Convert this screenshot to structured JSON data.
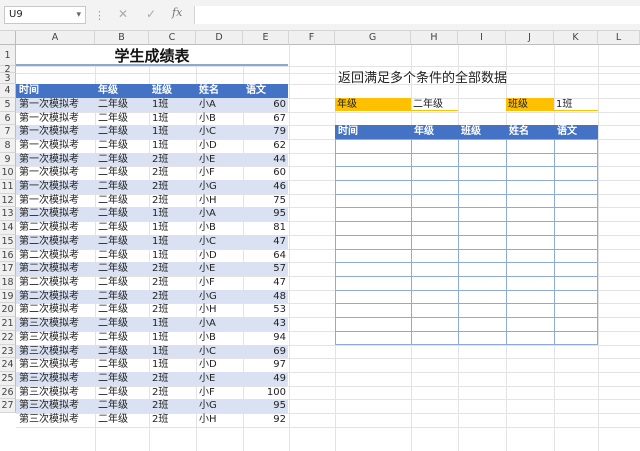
{
  "formula_bar": {
    "name_box": "U9",
    "fx_label": "fx",
    "formula": ""
  },
  "columns": [
    "A",
    "B",
    "C",
    "D",
    "E",
    "F",
    "G",
    "H",
    "I",
    "J",
    "K",
    "L"
  ],
  "rows": [
    "1",
    "2",
    "3",
    "4",
    "5",
    "6",
    "7",
    "8",
    "9",
    "10",
    "11",
    "12",
    "13",
    "14",
    "15",
    "16",
    "17",
    "18",
    "19",
    "20",
    "21",
    "22",
    "23",
    "24",
    "25",
    "26",
    "27"
  ],
  "table": {
    "title": "学生成绩表",
    "headers": [
      "时间",
      "年级",
      "班级",
      "姓名",
      "语文"
    ],
    "data": [
      [
        "第一次模拟考",
        "二年级",
        "1班",
        "小A",
        "60"
      ],
      [
        "第一次模拟考",
        "二年级",
        "1班",
        "小B",
        "67"
      ],
      [
        "第一次模拟考",
        "二年级",
        "1班",
        "小C",
        "79"
      ],
      [
        "第一次模拟考",
        "二年级",
        "1班",
        "小D",
        "62"
      ],
      [
        "第一次模拟考",
        "二年级",
        "2班",
        "小E",
        "44"
      ],
      [
        "第一次模拟考",
        "二年级",
        "2班",
        "小F",
        "60"
      ],
      [
        "第一次模拟考",
        "二年级",
        "2班",
        "小G",
        "46"
      ],
      [
        "第一次模拟考",
        "二年级",
        "2班",
        "小H",
        "75"
      ],
      [
        "第二次模拟考",
        "二年级",
        "1班",
        "小A",
        "95"
      ],
      [
        "第二次模拟考",
        "二年级",
        "1班",
        "小B",
        "81"
      ],
      [
        "第二次模拟考",
        "二年级",
        "1班",
        "小C",
        "47"
      ],
      [
        "第二次模拟考",
        "二年级",
        "1班",
        "小D",
        "64"
      ],
      [
        "第二次模拟考",
        "二年级",
        "2班",
        "小E",
        "57"
      ],
      [
        "第二次模拟考",
        "二年级",
        "2班",
        "小F",
        "47"
      ],
      [
        "第二次模拟考",
        "二年级",
        "2班",
        "小G",
        "48"
      ],
      [
        "第二次模拟考",
        "二年级",
        "2班",
        "小H",
        "53"
      ],
      [
        "第三次模拟考",
        "二年级",
        "1班",
        "小A",
        "43"
      ],
      [
        "第三次模拟考",
        "二年级",
        "1班",
        "小B",
        "94"
      ],
      [
        "第三次模拟考",
        "二年级",
        "1班",
        "小C",
        "69"
      ],
      [
        "第三次模拟考",
        "二年级",
        "1班",
        "小D",
        "97"
      ],
      [
        "第三次模拟考",
        "二年级",
        "2班",
        "小E",
        "49"
      ],
      [
        "第三次模拟考",
        "二年级",
        "2班",
        "小F",
        "100"
      ],
      [
        "第三次模拟考",
        "二年级",
        "2班",
        "小G",
        "95"
      ],
      [
        "第三次模拟考",
        "二年级",
        "2班",
        "小H",
        "92"
      ]
    ]
  },
  "query": {
    "title": "返回满足多个条件的全部数据",
    "criteria": [
      {
        "label": "年级",
        "value": "二年级"
      },
      {
        "label": "班级",
        "value": "1班"
      }
    ],
    "headers": [
      "时间",
      "年级",
      "班级",
      "姓名",
      "语文"
    ]
  },
  "colors": {
    "header_blue": "#4472c4",
    "band_blue": "#d9e1f2",
    "criteria_orange": "#ffc000"
  }
}
